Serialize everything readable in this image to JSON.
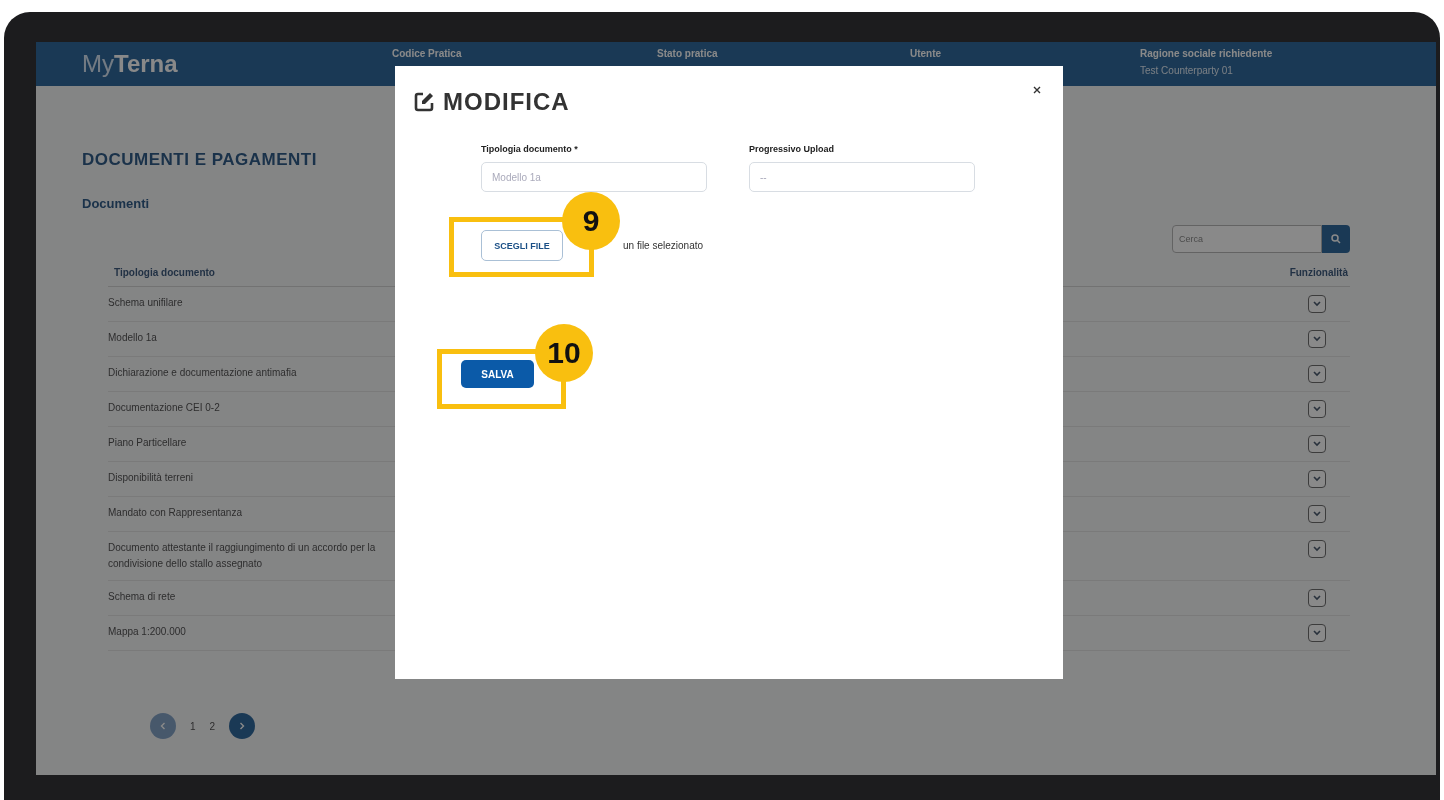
{
  "header": {
    "logo": {
      "prefix": "My",
      "name": "Terna"
    },
    "columns": [
      {
        "label": "Codice Pratica"
      },
      {
        "label": "Stato pratica"
      },
      {
        "label": "Utente"
      },
      {
        "label": "Ragione sociale richiedente",
        "value": "Test Counterparty 01"
      }
    ]
  },
  "page": {
    "title": "DOCUMENTI E PAGAMENTI",
    "section": "Documenti",
    "search": {
      "placeholder": "Cerca"
    },
    "table": {
      "columns": [
        "Tipologia documento",
        "Funzionalità"
      ],
      "rows": [
        {
          "name": "Schema unifilare"
        },
        {
          "name": "Modello 1a"
        },
        {
          "name": "Dichiarazione e documentazione antimafia"
        },
        {
          "name": "Documentazione CEI 0-2"
        },
        {
          "name": "Piano Particellare"
        },
        {
          "name": "Disponibilità terreni"
        },
        {
          "name": "Mandato con Rappresentanza"
        },
        {
          "name": "Documento attestante il raggiungimento di un accordo per la condivisione dello stallo assegnato"
        },
        {
          "name": "Schema di rete"
        },
        {
          "name": "Mappa 1:200.000"
        }
      ]
    },
    "pagination": [
      {
        "kind": "prev",
        "disabled": true
      },
      {
        "kind": "page",
        "label": "1"
      },
      {
        "kind": "page",
        "label": "2"
      },
      {
        "kind": "next",
        "disabled": false
      }
    ]
  },
  "modal": {
    "title": "MODIFICA",
    "fields": [
      {
        "label": "Tipologia documento *",
        "value": "Modello 1a",
        "disabled": true
      },
      {
        "label": "Progressivo Upload",
        "value": "--",
        "disabled": true
      }
    ],
    "file": {
      "button": "SCEGLI FILE",
      "status": "un file selezionato"
    },
    "save": "SALVA"
  },
  "annotations": [
    {
      "number": "9"
    },
    {
      "number": "10"
    }
  ]
}
